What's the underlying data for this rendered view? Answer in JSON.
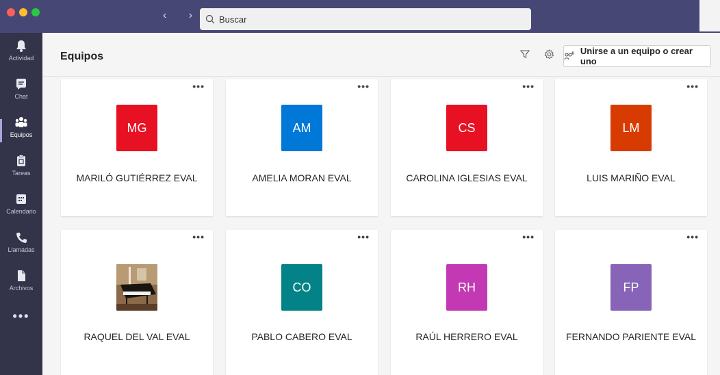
{
  "window": {
    "traffic_lights": [
      "#ff5f57",
      "#febc2e",
      "#28c840"
    ],
    "nav_arrows": "‹  ›"
  },
  "search": {
    "placeholder": "Buscar"
  },
  "rail": {
    "items": [
      {
        "label": "Actividad",
        "icon": "bell-icon"
      },
      {
        "label": "Chat",
        "icon": "chat-icon"
      },
      {
        "label": "Equipos",
        "icon": "teams-icon",
        "active": true
      },
      {
        "label": "Tareas",
        "icon": "tasks-icon"
      },
      {
        "label": "Calendario",
        "icon": "calendar-icon"
      },
      {
        "label": "Llamadas",
        "icon": "phone-icon"
      },
      {
        "label": "Archivos",
        "icon": "files-icon"
      }
    ],
    "more": "•••"
  },
  "header": {
    "title": "Equipos",
    "join_button": "Unirse a un equipo o crear uno",
    "filter_icon": "filter-icon",
    "settings_icon": "gear-icon"
  },
  "teams": [
    {
      "initials": "MG",
      "name": "MARILÓ GUTIÉRREZ EVAL",
      "color": "#e81123"
    },
    {
      "initials": "AM",
      "name": "AMELIA MORAN EVAL",
      "color": "#0078d7"
    },
    {
      "initials": "CS",
      "name": "CAROLINA IGLESIAS EVAL",
      "color": "#e81123"
    },
    {
      "initials": "LM",
      "name": "LUIS MARIÑO EVAL",
      "color": "#d83b01"
    },
    {
      "initials": "",
      "name": "RAQUEL DEL VAL EVAL",
      "color": "#7a5a3a",
      "image": "piano-photo"
    },
    {
      "initials": "CO",
      "name": "PABLO CABERO EVAL",
      "color": "#038387"
    },
    {
      "initials": "RH",
      "name": "RAÚL HERRERO EVAL",
      "color": "#c239b3"
    },
    {
      "initials": "FP",
      "name": "FERNANDO PARIENTE EVAL",
      "color": "#8764b8"
    }
  ],
  "card_more": "•••"
}
